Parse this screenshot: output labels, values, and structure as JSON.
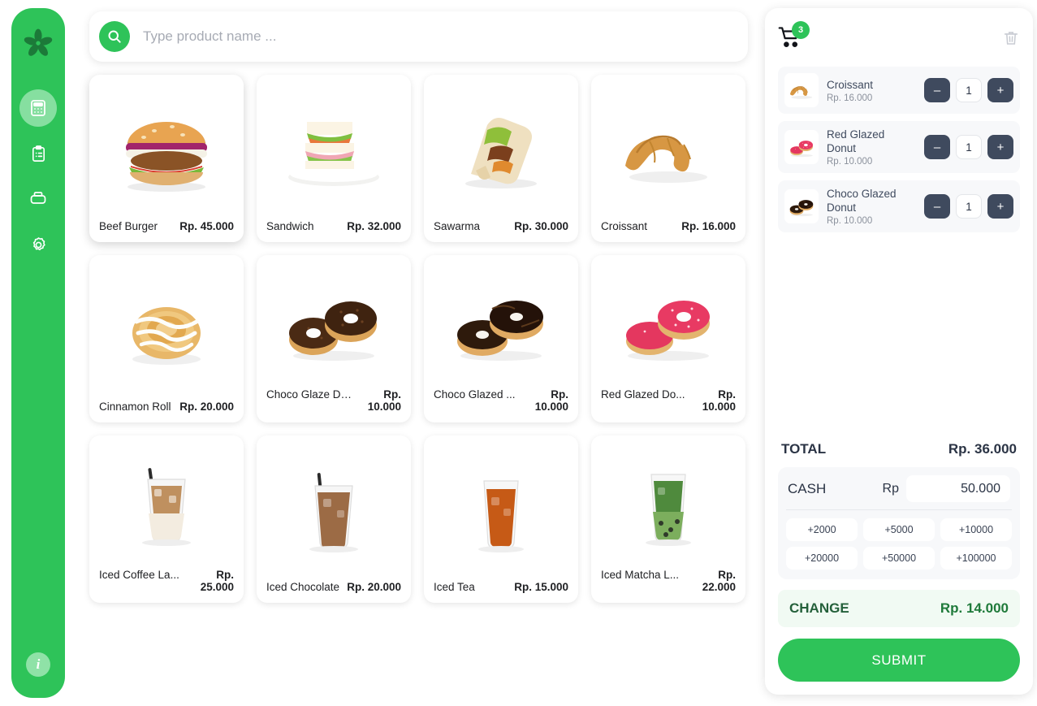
{
  "brand": {
    "logo_icon": "flower-logo",
    "color": "#2ec359"
  },
  "sidebar": {
    "items": [
      {
        "icon": "calculator-icon",
        "name": "cashier",
        "active": true
      },
      {
        "icon": "clipboard-list-icon",
        "name": "orders",
        "active": false
      },
      {
        "icon": "printer-icon",
        "name": "printer",
        "active": false
      },
      {
        "icon": "gear-icon",
        "name": "settings",
        "active": false
      }
    ],
    "info": {
      "icon": "info-icon",
      "label": "i"
    }
  },
  "search": {
    "icon": "search-icon",
    "placeholder": "Type product name ...",
    "value": ""
  },
  "products": [
    {
      "name": "Beef Burger",
      "price": "Rp. 45.000",
      "art": "burger",
      "selected": true,
      "wrap": false
    },
    {
      "name": "Sandwich",
      "price": "Rp. 32.000",
      "art": "sandwich",
      "selected": false,
      "wrap": false
    },
    {
      "name": "Sawarma",
      "price": "Rp. 30.000",
      "art": "wrap",
      "selected": false,
      "wrap": false
    },
    {
      "name": "Croissant",
      "price": "Rp. 16.000",
      "art": "croissant",
      "selected": false,
      "wrap": false
    },
    {
      "name": "Cinnamon Roll",
      "price": "Rp. 20.000",
      "art": "cinnamon",
      "selected": false,
      "wrap": false
    },
    {
      "name": "Choco Glaze Don...",
      "price": "Rp. 10.000",
      "art": "chocodonut",
      "selected": false,
      "wrap": true
    },
    {
      "name": "Choco Glazed ...",
      "price": "Rp. 10.000",
      "art": "chocoglazed",
      "selected": false,
      "wrap": true
    },
    {
      "name": "Red Glazed Do...",
      "price": "Rp. 10.000",
      "art": "reddonut",
      "selected": false,
      "wrap": true
    },
    {
      "name": "Iced Coffee La...",
      "price": "Rp. 25.000",
      "art": "icedlatte",
      "selected": false,
      "wrap": true
    },
    {
      "name": "Iced Chocolate",
      "price": "Rp. 20.000",
      "art": "icedchoco",
      "selected": false,
      "wrap": false
    },
    {
      "name": "Iced Tea",
      "price": "Rp. 15.000",
      "art": "icedtea",
      "selected": false,
      "wrap": false
    },
    {
      "name": "Iced Matcha L...",
      "price": "Rp. 22.000",
      "art": "icedmatcha",
      "selected": false,
      "wrap": true
    }
  ],
  "cart": {
    "icon": "shopping-cart-icon",
    "badge_count": "3",
    "clear_icon": "trash-icon",
    "items": [
      {
        "name": "Croissant",
        "price": "Rp. 16.000",
        "qty": "1",
        "art": "croissant",
        "minus": "–",
        "plus": "+"
      },
      {
        "name": "Red Glazed Donut",
        "price": "Rp. 10.000",
        "qty": "1",
        "art": "reddonut",
        "minus": "–",
        "plus": "+"
      },
      {
        "name": "Choco Glazed Donut",
        "price": "Rp. 10.000",
        "qty": "1",
        "art": "chocoglazed",
        "minus": "–",
        "plus": "+"
      }
    ]
  },
  "checkout": {
    "total_label": "TOTAL",
    "total_value": "Rp. 36.000",
    "cash_label": "CASH",
    "cash_currency": "Rp",
    "cash_value": "50.000",
    "quick_amounts": [
      "+2000",
      "+5000",
      "+10000",
      "+20000",
      "+50000",
      "+100000"
    ],
    "change_label": "CHANGE",
    "change_value": "Rp. 14.000",
    "submit_label": "SUBMIT"
  }
}
